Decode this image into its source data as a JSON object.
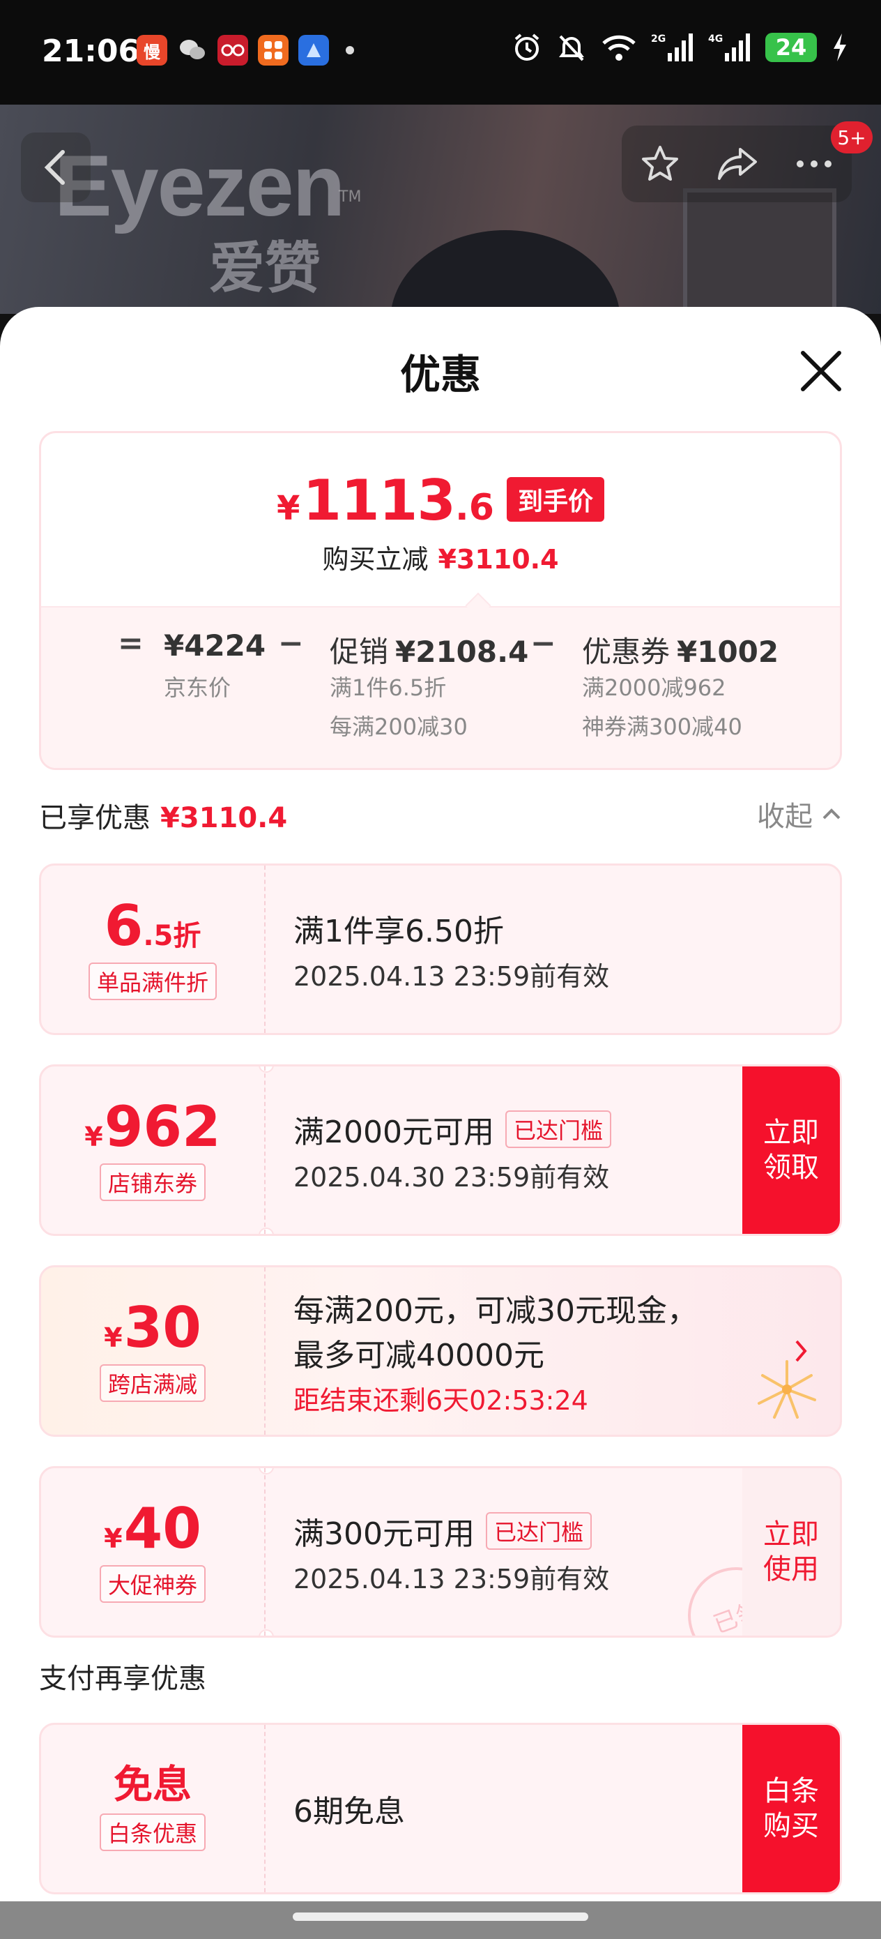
{
  "status_bar": {
    "time": "21:06",
    "apps": [
      {
        "icon": "sogou-icon",
        "glyph": "慢",
        "color": "#e8462a"
      },
      {
        "icon": "wechat-icon",
        "glyph": "",
        "color": "#111"
      },
      {
        "icon": "tmall-icon",
        "glyph": "",
        "color": "#c91c2c"
      },
      {
        "icon": "taobao-icon",
        "glyph": "",
        "color": "#f06b1f"
      },
      {
        "icon": "browser-icon",
        "glyph": "",
        "color": "#2a6fe0"
      }
    ],
    "battery": "24",
    "network_2g": "2G",
    "network_4g": "4G"
  },
  "background": {
    "brand_en": "Eyezen",
    "brand_cn": "爱赞",
    "notification_badge": "5+"
  },
  "sheet": {
    "title": "优惠"
  },
  "summary": {
    "currency": "¥",
    "final_int": "1113",
    "final_dec": ".6",
    "final_tag": "到手价",
    "save_label": "购买立减",
    "save_amount": "¥3110.4",
    "equals": "=",
    "minus": "−",
    "jd_price": "¥4224",
    "jd_price_label": "京东价",
    "promo_label": "促销",
    "promo_amount": "¥2108.4",
    "promo_lines": [
      "满1件6.5折",
      "每满200减30"
    ],
    "coupon_label": "优惠券",
    "coupon_amount": "¥1002",
    "coupon_lines": [
      "满2000减962",
      "神券满300减40"
    ]
  },
  "enjoyed": {
    "label": "已享优惠",
    "amount": "¥3110.4",
    "collapse_label": "收起"
  },
  "coupons": [
    {
      "value_big": "6",
      "value_small": ".5折",
      "tag": "单品满件折",
      "title": "满1件享6.50折",
      "valid": "2025.04.13 23:59前有效"
    },
    {
      "currency": "¥",
      "value": "962",
      "tag": "店铺东券",
      "title": "满2000元可用",
      "meet": "已达门槛",
      "valid": "2025.04.30 23:59前有效",
      "button": [
        "立即",
        "领取"
      ]
    },
    {
      "currency": "¥",
      "value": "30",
      "tag": "跨店满减",
      "title_lines": [
        "每满200元，可减30元现金，",
        "最多可减40000元"
      ],
      "countdown": "距结束还剩6天02:53:24"
    },
    {
      "currency": "¥",
      "value": "40",
      "tag": "大促神券",
      "title": "满300元可用",
      "meet": "已达门槛",
      "valid": "2025.04.13 23:59前有效",
      "button": [
        "立即",
        "使用"
      ],
      "stamp": "已领"
    }
  ],
  "payment": {
    "section_label": "支付再享优惠",
    "value": "免息",
    "tag": "白条优惠",
    "title": "6期免息",
    "button": [
      "白条",
      "购买"
    ]
  },
  "colors": {
    "accent_red": "#f01a32",
    "button_red": "#f5112c",
    "card_pink": "#fff3f5"
  }
}
